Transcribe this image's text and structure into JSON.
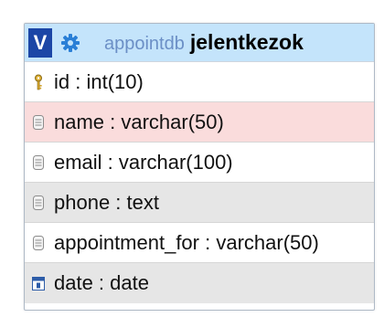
{
  "table": {
    "toggle_label": "V",
    "database_name": "appointdb",
    "table_name": "jelentkezok",
    "rows": [
      {
        "text": "id : int(10)",
        "icon": "key-icon",
        "bg": "#ffffff"
      },
      {
        "text": "name : varchar(50)",
        "icon": "column-icon",
        "bg": "#fadcdc"
      },
      {
        "text": "email : varchar(100)",
        "icon": "column-icon",
        "bg": "#ffffff"
      },
      {
        "text": "phone : text",
        "icon": "column-icon",
        "bg": "#e6e6e6"
      },
      {
        "text": "appointment_for : varchar(50)",
        "icon": "column-icon",
        "bg": "#ffffff"
      },
      {
        "text": "date : date",
        "icon": "date-icon",
        "bg": "#e6e6e6"
      }
    ]
  },
  "colors": {
    "header_bg": "#c4e4fb",
    "toggle_bg": "#1c46a6",
    "db_name": "#6b8fc6"
  }
}
